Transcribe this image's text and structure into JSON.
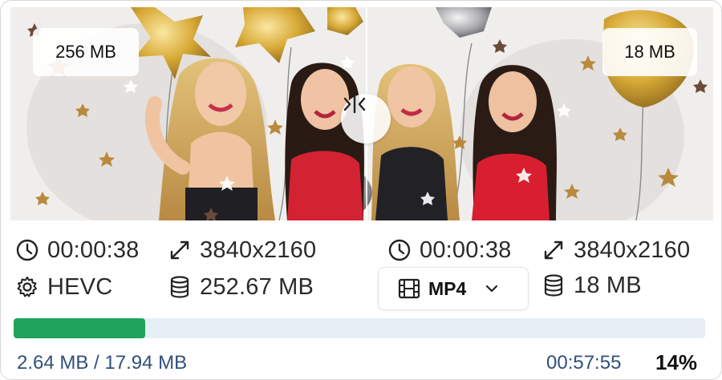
{
  "preview": {
    "original_size": "256 MB",
    "converted_size": "18 MB"
  },
  "original": {
    "duration": "00:00:38",
    "resolution": "3840x2160",
    "codec": "HEVC",
    "file_size": "252.67 MB"
  },
  "output": {
    "duration": "00:00:38",
    "resolution": "3840x2160",
    "format": "MP4",
    "file_size": "18 MB"
  },
  "progress": {
    "transferred": "2.64 MB / 17.94 MB",
    "time_remaining": "00:57:55",
    "percent_label": "14%",
    "fraction": 0.19
  },
  "colors": {
    "progress_fill": "#1fa35b",
    "progress_track": "#e6eef6",
    "progress_text": "#30507a"
  },
  "icons": {
    "duration": "clock-icon",
    "resolution": "expand-arrows-icon",
    "codec": "gear-icon",
    "file_size": "database-icon",
    "format": "film-icon",
    "dropdown": "chevron-down-icon",
    "compare": "split-compare-icon"
  }
}
